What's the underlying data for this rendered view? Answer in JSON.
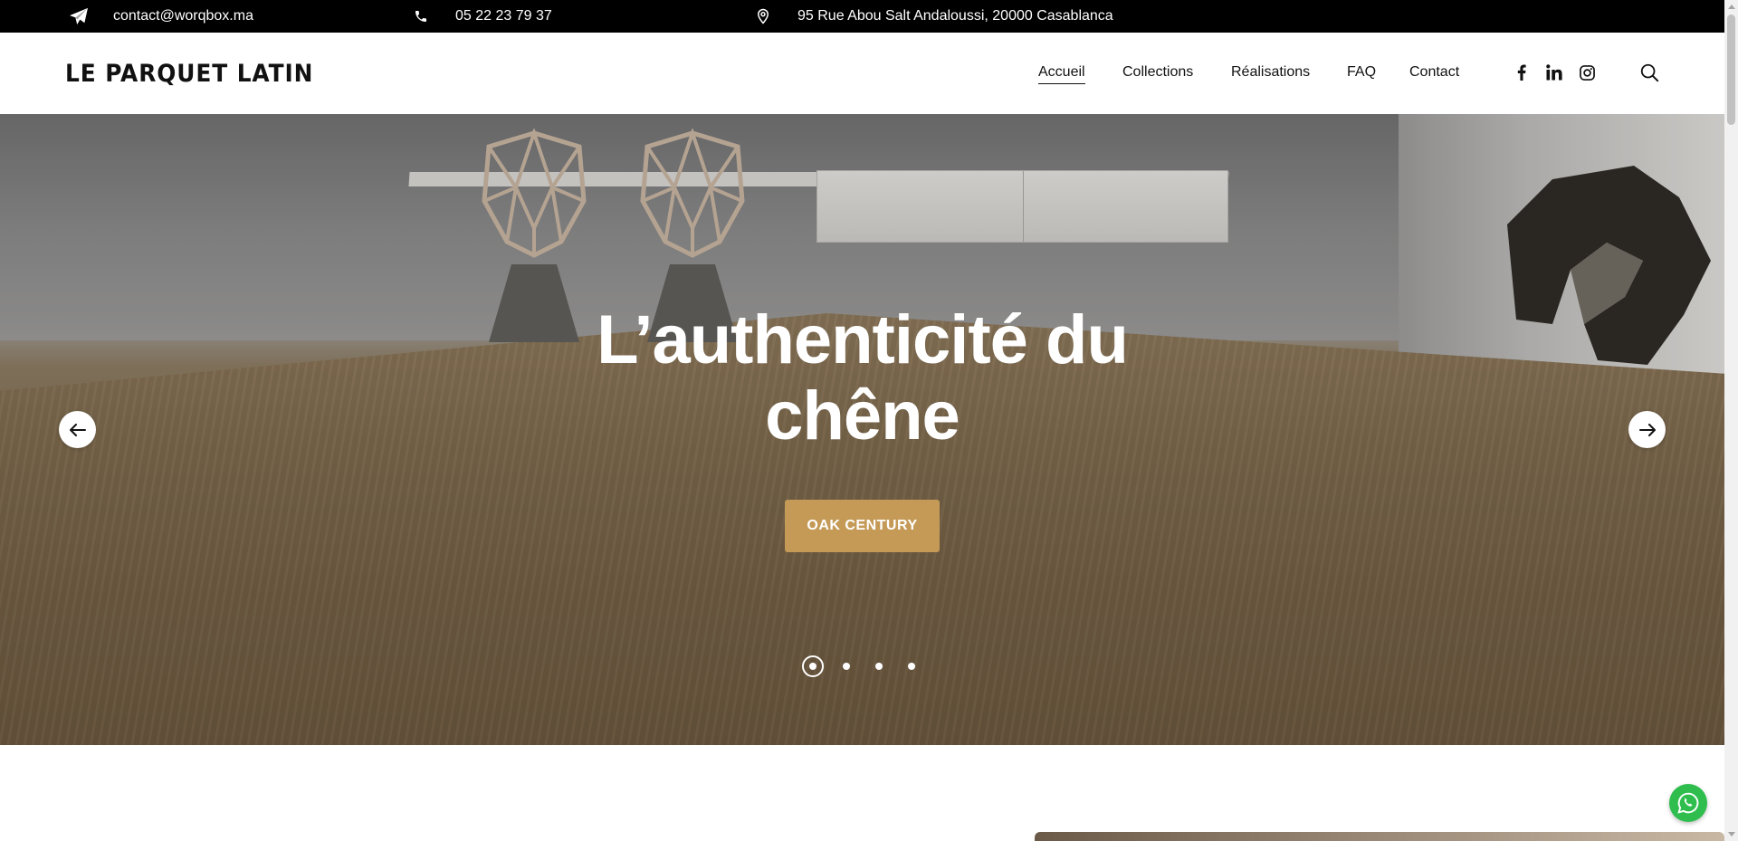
{
  "topbar": {
    "email": "contact@worqbox.ma",
    "phone": "05 22 23 79 37",
    "address": "95 Rue Abou Salt Andaloussi, 20000 Casablanca",
    "icons": [
      "paper-plane-icon",
      "phone-icon",
      "map-pin-icon"
    ]
  },
  "header": {
    "logo": "LE PARQUET LATIN",
    "nav": [
      {
        "label": "Accueil",
        "active": true
      },
      {
        "label": "Collections"
      },
      {
        "label": "Réalisations"
      },
      {
        "label": "FAQ"
      },
      {
        "label": "Contact"
      }
    ],
    "social_icons": [
      "facebook-icon",
      "linkedin-icon",
      "instagram-icon"
    ],
    "search_icon": "search-icon"
  },
  "hero": {
    "title": "L’authenticité du chêne",
    "button_label": "OAK CENTURY",
    "button_color": "#c49a56",
    "slides_total": 4,
    "active_slide": 1
  },
  "colors": {
    "topbar_bg": "#000000",
    "accent": "#c49a56",
    "whatsapp": "#2fbe4e"
  }
}
